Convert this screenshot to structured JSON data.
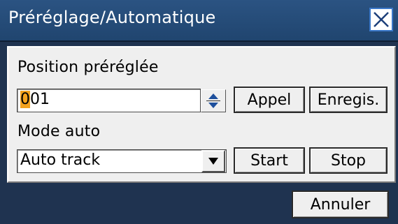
{
  "window": {
    "title": "Préréglage/Automatique",
    "close_icon": "close-icon"
  },
  "preset": {
    "label": "Position préréglée",
    "value_first_digit": "0",
    "value_rest": "01",
    "spinner_icon": "up-down-spinner-icon",
    "call_label": "Appel",
    "register_label": "Enregis."
  },
  "auto": {
    "label": "Mode auto",
    "selected": "Auto track",
    "dropdown_icon": "chevron-down-icon",
    "start_label": "Start",
    "stop_label": "Stop"
  },
  "footer": {
    "cancel_label": "Annuler"
  },
  "colors": {
    "titlebar": "#2b5382",
    "background": "#1f3350",
    "panel": "#efefef",
    "caret_highlight": "#f4a21d",
    "close_border": "#3b78c9"
  }
}
